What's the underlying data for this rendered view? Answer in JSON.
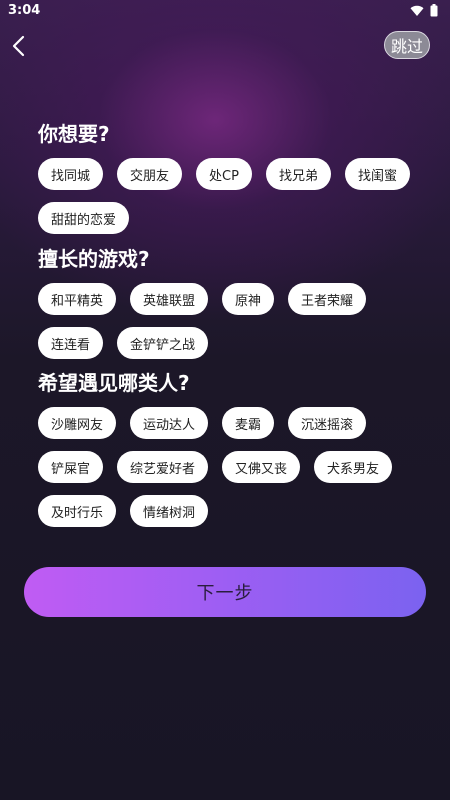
{
  "status": {
    "time": "3:04"
  },
  "header": {
    "skip_label": "跳过"
  },
  "sections": [
    {
      "title": "你想要?",
      "tags": [
        "找同城",
        "交朋友",
        "处CP",
        "找兄弟",
        "找闺蜜",
        "甜甜的恋爱"
      ]
    },
    {
      "title": "擅长的游戏?",
      "tags": [
        "和平精英",
        "英雄联盟",
        "原神",
        "王者荣耀",
        "连连看",
        "金铲铲之战"
      ]
    },
    {
      "title": "希望遇见哪类人?",
      "tags": [
        "沙雕网友",
        "运动达人",
        "麦霸",
        "沉迷摇滚",
        "铲屎官",
        "综艺爱好者",
        "又佛又丧",
        "犬系男友",
        "及时行乐",
        "情绪树洞"
      ]
    }
  ],
  "footer": {
    "next_label": "下一步"
  },
  "icons": {
    "wifi": "wifi-icon",
    "battery": "battery-icon",
    "back": "back-arrow-icon"
  },
  "colors": {
    "accent_start": "#c05cf3",
    "accent_end": "#7b62f0"
  }
}
